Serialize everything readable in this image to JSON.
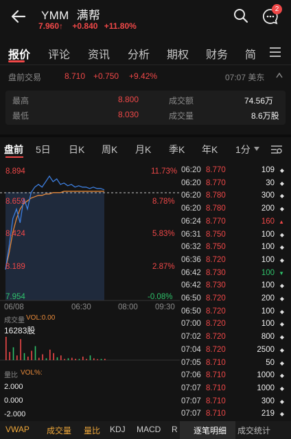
{
  "header": {
    "ticker": "YMM",
    "name": "满帮",
    "price": "7.960",
    "price_arrow": "↑",
    "change": "+0.840",
    "change_pct": "+11.80%",
    "notif_count": "2"
  },
  "tabs": [
    "报价",
    "评论",
    "资讯",
    "分析",
    "期权",
    "财务",
    "简"
  ],
  "premarket": {
    "label": "盘前交易",
    "price": "8.710",
    "change": "+0.750",
    "pct": "+9.42%",
    "time": "07:07 美东"
  },
  "stats": {
    "high_label": "最高",
    "high": "8.800",
    "turnover_label": "成交额",
    "turnover": "74.56万",
    "low_label": "最低",
    "low": "8.030",
    "volume_label": "成交量",
    "volume": "8.6万股"
  },
  "periods": [
    "盘前",
    "5日",
    "日K",
    "周K",
    "月K",
    "季K",
    "年K",
    "1分"
  ],
  "chart": {
    "left_labels": [
      "8.894",
      "8.659",
      "8.424",
      "8.189",
      "7.954"
    ],
    "right_labels": [
      "11.73%",
      "8.78%",
      "5.83%",
      "2.87%",
      "-0.08%"
    ],
    "time_labels": [
      "06/08",
      "06:30",
      "08:00",
      "09:30"
    ],
    "colors": {
      "price": "#3d7fe0",
      "avg": "#e88a3a",
      "ref": "#c8c8c8"
    },
    "price_series": [
      8.18,
      8.35,
      8.55,
      8.62,
      8.52,
      8.7,
      8.62,
      8.74,
      8.78,
      8.8,
      8.78,
      8.82,
      8.86,
      8.82,
      8.84,
      8.8,
      8.81,
      8.79,
      8.8,
      8.78,
      8.79,
      8.78,
      8.78,
      8.77,
      8.78,
      8.77,
      8.77,
      8.76
    ],
    "avg_series": [
      8.18,
      8.3,
      8.45,
      8.55,
      8.62,
      8.66,
      8.68,
      8.7,
      8.71,
      8.72,
      8.72,
      8.73,
      8.73,
      8.74,
      8.74,
      8.74,
      8.75,
      8.75,
      8.75,
      8.75,
      8.75,
      8.75,
      8.75,
      8.75,
      8.75,
      8.75,
      8.75,
      8.75
    ],
    "ref_value": 8.77
  },
  "volume": {
    "label": "成交量",
    "vol_label": "VOL:0.00",
    "vol_value": "16283股",
    "bars": [
      1.0,
      0.35,
      0.55,
      0.2,
      0.9,
      0.3,
      0.15,
      0.4,
      0.6,
      0.1,
      0.25,
      0.08,
      0.45,
      0.3,
      0.12,
      0.2,
      0.05,
      0.08,
      0.1,
      0.06,
      0.05,
      0.15,
      0.05,
      0.2,
      0.08,
      0.04,
      0.05,
      0.06
    ]
  },
  "indicator": {
    "label": "量比",
    "vol_pct": "VOL%:",
    "levels": [
      "2.000",
      "0.000",
      "-2.000"
    ]
  },
  "ticks": [
    {
      "time": "06:20",
      "price": "8.770",
      "vol": "109",
      "dir": "◆",
      "pc": "red",
      "vc": "white"
    },
    {
      "time": "06:20",
      "price": "8.770",
      "vol": "30",
      "dir": "◆",
      "pc": "red",
      "vc": "white"
    },
    {
      "time": "06:20",
      "price": "8.780",
      "vol": "300",
      "dir": "◆",
      "pc": "red",
      "vc": "white"
    },
    {
      "time": "06:20",
      "price": "8.780",
      "vol": "200",
      "dir": "◆",
      "pc": "red",
      "vc": "white"
    },
    {
      "time": "06:24",
      "price": "8.770",
      "vol": "160",
      "dir": "▲",
      "pc": "red",
      "vc": "red"
    },
    {
      "time": "06:31",
      "price": "8.750",
      "vol": "100",
      "dir": "◆",
      "pc": "red",
      "vc": "white"
    },
    {
      "time": "06:32",
      "price": "8.750",
      "vol": "100",
      "dir": "◆",
      "pc": "red",
      "vc": "white"
    },
    {
      "time": "06:36",
      "price": "8.720",
      "vol": "100",
      "dir": "◆",
      "pc": "red",
      "vc": "white"
    },
    {
      "time": "06:42",
      "price": "8.730",
      "vol": "100",
      "dir": "▼",
      "pc": "red",
      "vc": "green"
    },
    {
      "time": "06:42",
      "price": "8.730",
      "vol": "100",
      "dir": "◆",
      "pc": "red",
      "vc": "white"
    },
    {
      "time": "06:50",
      "price": "8.720",
      "vol": "200",
      "dir": "◆",
      "pc": "red",
      "vc": "white"
    },
    {
      "time": "06:50",
      "price": "8.720",
      "vol": "100",
      "dir": "◆",
      "pc": "red",
      "vc": "white"
    },
    {
      "time": "07:00",
      "price": "8.720",
      "vol": "100",
      "dir": "◆",
      "pc": "red",
      "vc": "white"
    },
    {
      "time": "07:02",
      "price": "8.720",
      "vol": "800",
      "dir": "◆",
      "pc": "red",
      "vc": "white"
    },
    {
      "time": "07:04",
      "price": "8.720",
      "vol": "2500",
      "dir": "◆",
      "pc": "red",
      "vc": "white"
    },
    {
      "time": "07:05",
      "price": "8.710",
      "vol": "50",
      "dir": "◆",
      "pc": "red",
      "vc": "white"
    },
    {
      "time": "07:06",
      "price": "8.710",
      "vol": "1000",
      "dir": "◆",
      "pc": "red",
      "vc": "white"
    },
    {
      "time": "07:07",
      "price": "8.710",
      "vol": "1000",
      "dir": "◆",
      "pc": "red",
      "vc": "white"
    },
    {
      "time": "07:07",
      "price": "8.710",
      "vol": "300",
      "dir": "◆",
      "pc": "red",
      "vc": "white"
    },
    {
      "time": "07:07",
      "price": "8.710",
      "vol": "219",
      "dir": "◆",
      "pc": "red",
      "vc": "white"
    }
  ],
  "bottom": {
    "items": [
      "VWAP",
      "成交量",
      "量比",
      "KDJ",
      "MACD",
      "R"
    ],
    "right_tabs": [
      "逐笔明细",
      "成交统计"
    ]
  }
}
